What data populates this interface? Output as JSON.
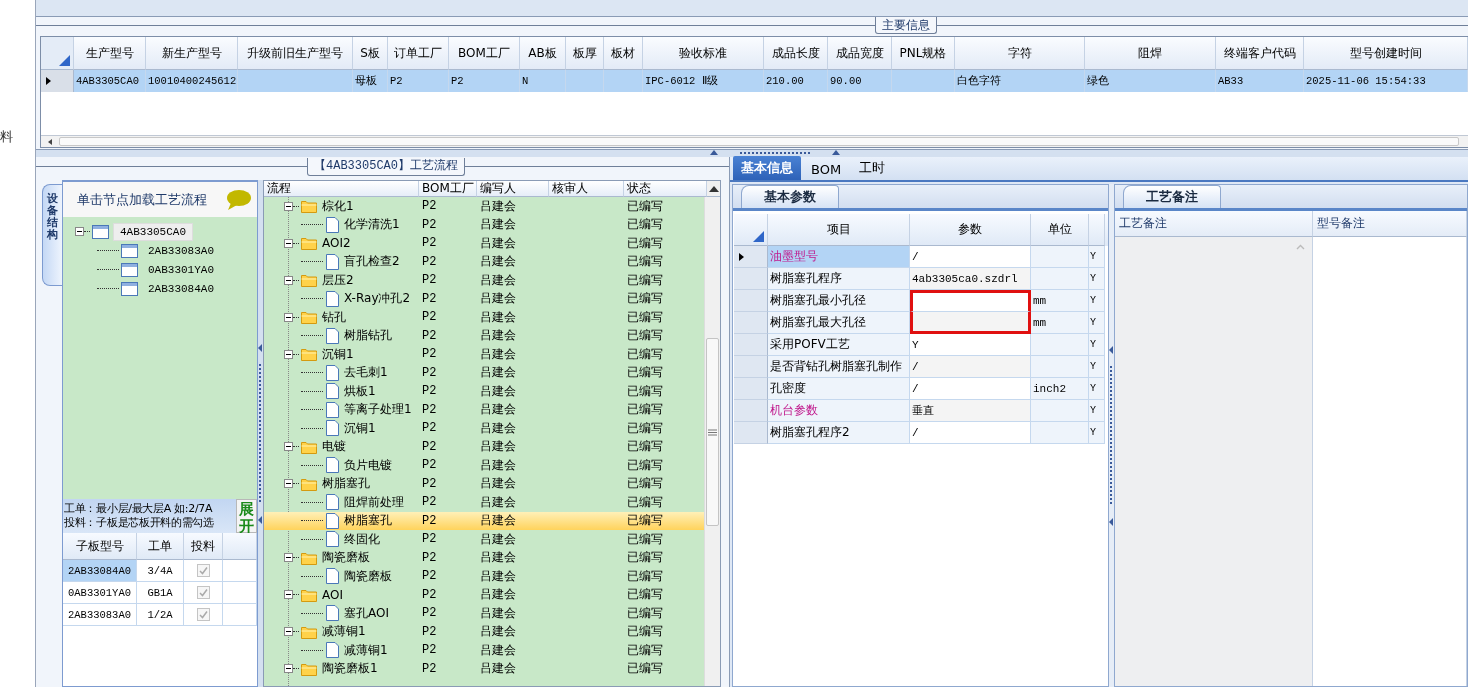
{
  "left_edge": {
    "text": "料"
  },
  "main_info": {
    "title": "主要信息",
    "columns": [
      "生产型号",
      "新生产型号",
      "升级前旧生产型号",
      "S板",
      "订单工厂",
      "BOM工厂",
      "AB板",
      "板厚",
      "板材",
      "验收标准",
      "成品长度",
      "成品宽度",
      "PNL规格",
      "字符",
      "阻焊",
      "终端客户代码",
      "型号创建时间"
    ],
    "rows": [
      {
        "selected": true,
        "cells": [
          "4AB3305CA0",
          "10010400245612",
          null,
          "母板",
          "P2",
          "P2",
          "N",
          null,
          null,
          "IPC-6012 Ⅱ级",
          "210.00",
          "90.00",
          null,
          "白色字符",
          "绿色",
          "AB33",
          "2025-11-06 15:54:33"
        ]
      }
    ]
  },
  "process_flow": {
    "title": "【4AB3305CA0】工艺流程",
    "side_tab": "设备结构",
    "hint": "单击节点加载工艺流程",
    "structure_tree": [
      {
        "label": "4AB3305CA0",
        "selected": true,
        "expanded": true,
        "children": [
          {
            "label": "2AB33083A0",
            "selected": false
          },
          {
            "label": "0AB3301YA0",
            "selected": false
          },
          {
            "label": "2AB33084A0",
            "selected": false
          }
        ]
      }
    ],
    "note": [
      "工单：最小层/最大层A 如:2/7A",
      "投料：子板是芯板开料的需勾选"
    ],
    "expand_button": "展开",
    "sub_boards": {
      "columns": [
        "子板型号",
        "工单",
        "投料"
      ],
      "rows": [
        {
          "board": "2AB33084A0",
          "order": "3/4A",
          "feed": true,
          "selected": true
        },
        {
          "board": "0AB3301YA0",
          "order": "GB1A",
          "feed": true,
          "selected": false
        },
        {
          "board": "2AB33083A0",
          "order": "1/2A",
          "feed": true,
          "selected": false
        }
      ]
    },
    "flow_table": {
      "columns": [
        "流程",
        "BOM工厂",
        "编写人",
        "核审人",
        "状态"
      ],
      "nodes": [
        {
          "kind": "folder",
          "label": "棕化1",
          "bom": "P2",
          "writer": "吕建会",
          "status": "已编写",
          "selected": false,
          "expanded": true,
          "children": [
            {
              "kind": "file",
              "label": "化学清洗1",
              "bom": "P2",
              "writer": "吕建会",
              "status": "已编写",
              "selected": false
            }
          ]
        },
        {
          "kind": "folder",
          "label": "AOI2",
          "bom": "P2",
          "writer": "吕建会",
          "status": "已编写",
          "selected": false,
          "expanded": true,
          "children": [
            {
              "kind": "file",
              "label": "盲孔检查2",
              "bom": "P2",
              "writer": "吕建会",
              "status": "已编写",
              "selected": false
            }
          ]
        },
        {
          "kind": "folder",
          "label": "层压2",
          "bom": "P2",
          "writer": "吕建会",
          "status": "已编写",
          "selected": false,
          "expanded": true,
          "children": [
            {
              "kind": "file",
              "label": "X-Ray冲孔2",
              "bom": "P2",
              "writer": "吕建会",
              "status": "已编写",
              "selected": false
            }
          ]
        },
        {
          "kind": "folder",
          "label": "钻孔",
          "bom": "P2",
          "writer": "吕建会",
          "status": "已编写",
          "selected": false,
          "expanded": true,
          "children": [
            {
              "kind": "file",
              "label": "树脂钻孔",
              "bom": "P2",
              "writer": "吕建会",
              "status": "已编写",
              "selected": false
            }
          ]
        },
        {
          "kind": "folder",
          "label": "沉铜1",
          "bom": "P2",
          "writer": "吕建会",
          "status": "已编写",
          "selected": false,
          "expanded": true,
          "children": [
            {
              "kind": "file",
              "label": "去毛刺1",
              "bom": "P2",
              "writer": "吕建会",
              "status": "已编写",
              "selected": false
            },
            {
              "kind": "file",
              "label": "烘板1",
              "bom": "P2",
              "writer": "吕建会",
              "status": "已编写",
              "selected": false
            },
            {
              "kind": "file",
              "label": "等离子处理1",
              "bom": "P2",
              "writer": "吕建会",
              "status": "已编写",
              "selected": false
            },
            {
              "kind": "file",
              "label": "沉铜1",
              "bom": "P2",
              "writer": "吕建会",
              "status": "已编写",
              "selected": false
            }
          ]
        },
        {
          "kind": "folder",
          "label": "电镀",
          "bom": "P2",
          "writer": "吕建会",
          "status": "已编写",
          "selected": false,
          "expanded": true,
          "children": [
            {
              "kind": "file",
              "label": "负片电镀",
              "bom": "P2",
              "writer": "吕建会",
              "status": "已编写",
              "selected": false
            }
          ]
        },
        {
          "kind": "folder",
          "label": "树脂塞孔",
          "bom": "P2",
          "writer": "吕建会",
          "status": "已编写",
          "selected": false,
          "expanded": true,
          "children": [
            {
              "kind": "file",
              "label": "阻焊前处理",
              "bom": "P2",
              "writer": "吕建会",
              "status": "已编写",
              "selected": false
            },
            {
              "kind": "file",
              "label": "树脂塞孔",
              "bom": "P2",
              "writer": "吕建会",
              "status": "已编写",
              "selected": true
            },
            {
              "kind": "file",
              "label": "终固化",
              "bom": "P2",
              "writer": "吕建会",
              "status": "已编写",
              "selected": false
            }
          ]
        },
        {
          "kind": "folder",
          "label": "陶瓷磨板",
          "bom": "P2",
          "writer": "吕建会",
          "status": "已编写",
          "selected": false,
          "expanded": true,
          "children": [
            {
              "kind": "file",
              "label": "陶瓷磨板",
              "bom": "P2",
              "writer": "吕建会",
              "status": "已编写",
              "selected": false
            }
          ]
        },
        {
          "kind": "folder",
          "label": "AOI",
          "bom": "P2",
          "writer": "吕建会",
          "status": "已编写",
          "selected": false,
          "expanded": true,
          "children": [
            {
              "kind": "file",
              "label": "塞孔AOI",
              "bom": "P2",
              "writer": "吕建会",
              "status": "已编写",
              "selected": false
            }
          ]
        },
        {
          "kind": "folder",
          "label": "减薄铜1",
          "bom": "P2",
          "writer": "吕建会",
          "status": "已编写",
          "selected": false,
          "expanded": true,
          "children": [
            {
              "kind": "file",
              "label": "减薄铜1",
              "bom": "P2",
              "writer": "吕建会",
              "status": "已编写",
              "selected": false
            }
          ]
        },
        {
          "kind": "folder",
          "label": "陶瓷磨板1",
          "bom": "P2",
          "writer": "吕建会",
          "status": "已编写",
          "selected": false,
          "expanded": true
        }
      ]
    }
  },
  "detail": {
    "tabs": [
      {
        "label": "基本信息",
        "selected": true
      },
      {
        "label": "BOM",
        "selected": false
      },
      {
        "label": "工时",
        "selected": false
      }
    ],
    "params": {
      "tab": "基本参数",
      "columns": [
        "项目",
        "参数",
        "单位"
      ],
      "rows": [
        {
          "item": "油墨型号",
          "value": "/",
          "flag": "Y",
          "highlighted": true,
          "selected": true,
          "framed": false
        },
        {
          "item": "树脂塞孔程序",
          "value": "4ab3305ca0.szdrl",
          "flag": "Y",
          "highlighted": false,
          "selected": false,
          "framed": false
        },
        {
          "item": "树脂塞孔最小孔径",
          "unit": "mm",
          "flag": "Y",
          "highlighted": false,
          "selected": false,
          "framed": true
        },
        {
          "item": "树脂塞孔最大孔径",
          "unit": "mm",
          "flag": "Y",
          "highlighted": false,
          "selected": false,
          "framed": true
        },
        {
          "item": "采用POFV工艺",
          "value": "Y",
          "flag": "Y",
          "highlighted": false,
          "selected": false,
          "framed": false
        },
        {
          "item": "是否背钻孔树脂塞孔制作",
          "value": "/",
          "flag": "Y",
          "highlighted": false,
          "selected": false,
          "framed": false
        },
        {
          "item": "孔密度",
          "value": "/",
          "unit": "inch2",
          "flag": "Y",
          "highlighted": false,
          "selected": false,
          "framed": false
        },
        {
          "item": "机台参数",
          "value": "垂直",
          "flag": "Y",
          "highlighted": true,
          "selected": false,
          "framed": false
        },
        {
          "item": "树脂塞孔程序2",
          "value": "/",
          "flag": "Y",
          "highlighted": false,
          "selected": false,
          "framed": false
        }
      ]
    },
    "notes": {
      "tab": "工艺备注",
      "columns": [
        "工艺备注",
        "型号备注"
      ]
    }
  }
}
